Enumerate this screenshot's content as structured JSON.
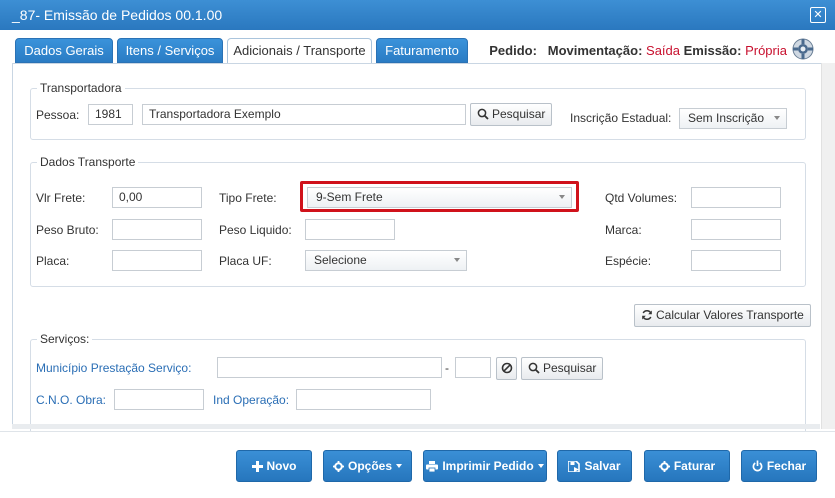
{
  "window": {
    "title": "_87- Emissão de Pedidos 00.1.00"
  },
  "tabs": [
    {
      "label": "Dados Gerais"
    },
    {
      "label": "Itens / Serviços"
    },
    {
      "label": "Adicionais / Transporte"
    },
    {
      "label": "Faturamento"
    }
  ],
  "header": {
    "pedido_label": "Pedido:",
    "movimentacao_label": "Movimentação:",
    "movimentacao_value": "Saída",
    "emissao_label": "Emissão:",
    "emissao_value": "Própria"
  },
  "transportadora": {
    "legend": "Transportadora",
    "pessoa_label": "Pessoa:",
    "pessoa_code": "1981",
    "pessoa_name": "Transportadora Exemplo",
    "pesquisar": "Pesquisar",
    "inscricao_label": "Inscrição Estadual:",
    "inscricao_value": "Sem Inscrição"
  },
  "dados_transporte": {
    "legend": "Dados Transporte",
    "vlr_frete_label": "Vlr Frete:",
    "vlr_frete_value": "0,00",
    "tipo_frete_label": "Tipo Frete:",
    "tipo_frete_value": "9-Sem Frete",
    "qtd_volumes_label": "Qtd Volumes:",
    "qtd_volumes_value": "",
    "peso_bruto_label": "Peso Bruto:",
    "peso_bruto_value": "",
    "peso_liquido_label": "Peso Liquido:",
    "peso_liquido_value": "",
    "marca_label": "Marca:",
    "marca_value": "",
    "placa_label": "Placa:",
    "placa_value": "",
    "placa_uf_label": "Placa UF:",
    "placa_uf_value": "Selecione",
    "especie_label": "Espécie:",
    "especie_value": ""
  },
  "calcular": {
    "label": "Calcular Valores Transporte"
  },
  "servicos": {
    "legend": "Serviços:",
    "municipio_label": "Município Prestação Serviço:",
    "municipio_code": "",
    "dash": "-",
    "municipio_extra": "",
    "pesquisar": "Pesquisar",
    "cno_label": "C.N.O. Obra:",
    "cno_value": "",
    "ind_label": "Ind Operação:",
    "ind_value": ""
  },
  "footer": {
    "novo": "Novo",
    "opcoes": "Opções",
    "imprimir": "Imprimir Pedido",
    "salvar": "Salvar",
    "faturar": "Faturar",
    "fechar": "Fechar"
  },
  "colors": {
    "accent": "#2a7cc4",
    "highlight": "#d0121b",
    "status_red": "#c8102e",
    "link_blue": "#2a6eb5"
  }
}
